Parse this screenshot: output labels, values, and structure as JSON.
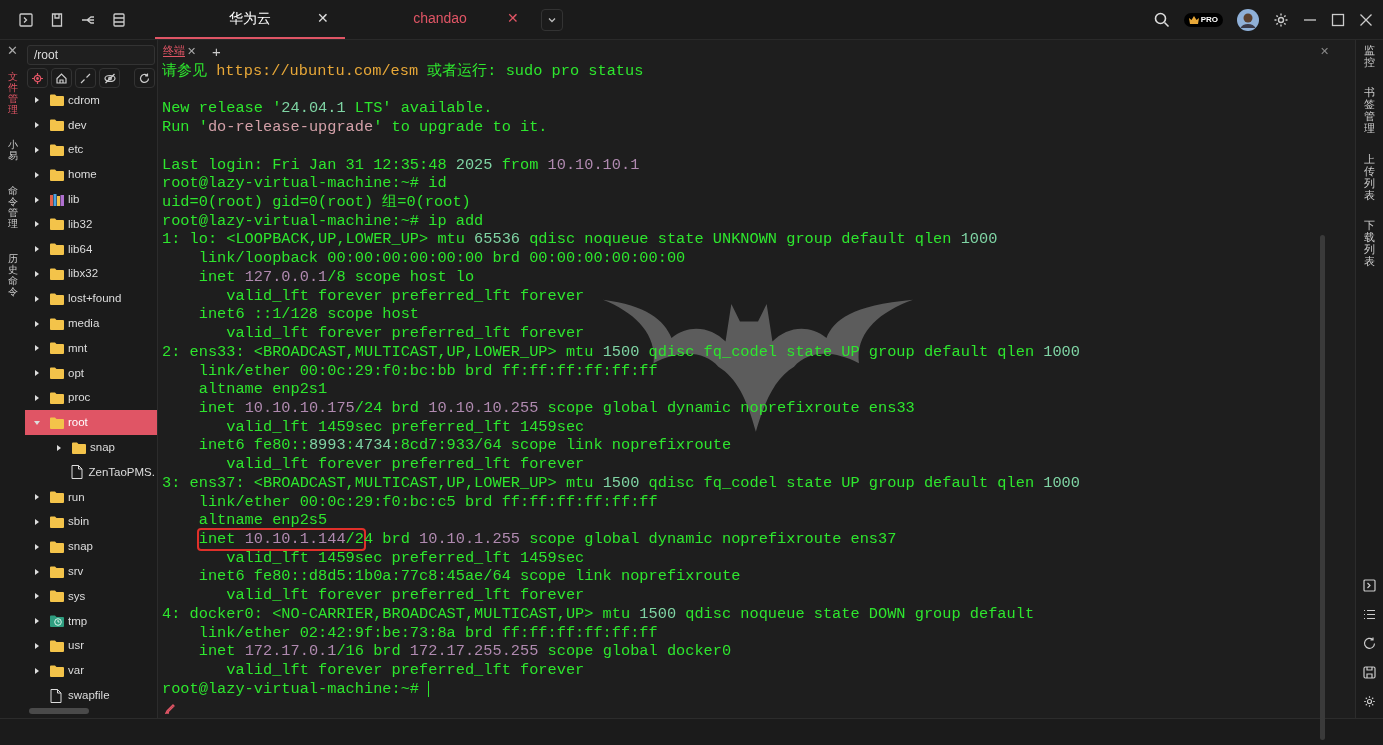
{
  "tabs": [
    {
      "label": "华为云",
      "selected": true,
      "close": "✕"
    },
    {
      "label": "chandao",
      "selected": false,
      "close": "✕"
    }
  ],
  "pro_badge": "PRO",
  "left_rail": {
    "close": "✕",
    "items": [
      {
        "label": "文件管理",
        "selected": true
      },
      {
        "label": "小易",
        "selected": false
      },
      {
        "label": "命令管理",
        "selected": false
      },
      {
        "label": "历史命令",
        "selected": false
      }
    ]
  },
  "file_panel": {
    "path": "/root",
    "tree": [
      {
        "label": "cdrom",
        "kind": "folder",
        "expanded": false,
        "selected": false
      },
      {
        "label": "dev",
        "kind": "folder",
        "expanded": false,
        "selected": false
      },
      {
        "label": "etc",
        "kind": "folder",
        "expanded": false,
        "selected": false
      },
      {
        "label": "home",
        "kind": "folder",
        "expanded": false,
        "selected": false
      },
      {
        "label": "lib",
        "kind": "library",
        "expanded": false,
        "selected": false
      },
      {
        "label": "lib32",
        "kind": "folder",
        "expanded": false,
        "selected": false
      },
      {
        "label": "lib64",
        "kind": "folder",
        "expanded": false,
        "selected": false
      },
      {
        "label": "libx32",
        "kind": "folder",
        "expanded": false,
        "selected": false
      },
      {
        "label": "lost+found",
        "kind": "folder",
        "expanded": false,
        "selected": false
      },
      {
        "label": "media",
        "kind": "folder",
        "expanded": false,
        "selected": false
      },
      {
        "label": "mnt",
        "kind": "folder",
        "expanded": false,
        "selected": false
      },
      {
        "label": "opt",
        "kind": "folder",
        "expanded": false,
        "selected": false
      },
      {
        "label": "proc",
        "kind": "folder",
        "expanded": false,
        "selected": false
      },
      {
        "label": "root",
        "kind": "folder",
        "expanded": true,
        "selected": true,
        "children": [
          {
            "label": "snap",
            "kind": "folder",
            "expanded": false,
            "selected": false
          },
          {
            "label": "ZenTaoPMS.",
            "kind": "file",
            "selected": false
          }
        ]
      },
      {
        "label": "run",
        "kind": "folder",
        "expanded": false,
        "selected": false
      },
      {
        "label": "sbin",
        "kind": "folder",
        "expanded": false,
        "selected": false
      },
      {
        "label": "snap",
        "kind": "folder",
        "expanded": false,
        "selected": false
      },
      {
        "label": "srv",
        "kind": "folder",
        "expanded": false,
        "selected": false
      },
      {
        "label": "sys",
        "kind": "folder",
        "expanded": false,
        "selected": false
      },
      {
        "label": "tmp",
        "kind": "temp",
        "expanded": false,
        "selected": false
      },
      {
        "label": "usr",
        "kind": "folder",
        "expanded": false,
        "selected": false
      },
      {
        "label": "var",
        "kind": "folder",
        "expanded": false,
        "selected": false
      },
      {
        "label": "swapfile",
        "kind": "file",
        "selected": false
      }
    ]
  },
  "terminal": {
    "tab": {
      "label": "终端",
      "close": "✕",
      "add": "+"
    },
    "close": "✕",
    "lines": [
      {
        "kind": "text",
        "segments": [
          {
            "text": "请参见 ",
            "color": "#2ee62e"
          },
          {
            "text": "https://ubuntu.com/esm",
            "color": "#e8a838"
          },
          {
            "text": " 或者运行: sudo pro status",
            "color": "#2ee62e"
          }
        ]
      },
      {
        "kind": "blank"
      },
      {
        "kind": "text",
        "segments": [
          {
            "text": "New release '",
            "color": "#2ee62e"
          },
          {
            "text": "24.04.1",
            "color": "#7fd4a4"
          },
          {
            "text": " LTS' available.",
            "color": "#2ee62e"
          }
        ]
      },
      {
        "kind": "text",
        "segments": [
          {
            "text": "Run '",
            "color": "#2ee62e"
          },
          {
            "text": "do-release-upgrade",
            "color": "#d3a0a8"
          },
          {
            "text": "' to upgrade to it.",
            "color": "#2ee62e"
          }
        ]
      },
      {
        "kind": "blank"
      },
      {
        "kind": "text",
        "segments": [
          {
            "text": "Last login: Fri Jan 31 12:35:48 ",
            "color": "#2ee62e"
          },
          {
            "text": "2025",
            "color": "#7fd4a4"
          },
          {
            "text": " from ",
            "color": "#2ee62e"
          },
          {
            "text": "10.10.10.1",
            "color": "#b08ab0"
          }
        ]
      },
      {
        "kind": "text",
        "segments": [
          {
            "text": "root@lazy-virtual-machine:~# id",
            "color": "#2ee62e"
          }
        ]
      },
      {
        "kind": "text",
        "segments": [
          {
            "text": "uid=0(root) gid=0(root) 组=0(root)",
            "color": "#2ee62e"
          }
        ]
      },
      {
        "kind": "text",
        "segments": [
          {
            "text": "root@lazy-virtual-machine:~# ip add",
            "color": "#2ee62e"
          }
        ]
      },
      {
        "kind": "text",
        "segments": [
          {
            "text": "1: lo: <LOOPBACK,UP,LOWER_UP> mtu ",
            "color": "#2ee62e"
          },
          {
            "text": "65536",
            "color": "#7fd4a4"
          },
          {
            "text": " qdisc noqueue state UNKNOWN group default qlen ",
            "color": "#2ee62e"
          },
          {
            "text": "1000",
            "color": "#7fd4a4"
          }
        ]
      },
      {
        "kind": "text",
        "segments": [
          {
            "text": "    link/loopback 00:00:00:00:00:00 brd 00:00:00:00:00:00",
            "color": "#2ee62e"
          }
        ]
      },
      {
        "kind": "text",
        "segments": [
          {
            "text": "    inet ",
            "color": "#2ee62e"
          },
          {
            "text": "127.0.0.1",
            "color": "#b08ab0"
          },
          {
            "text": "/8 scope host lo",
            "color": "#2ee62e"
          }
        ]
      },
      {
        "kind": "text",
        "segments": [
          {
            "text": "       valid_lft forever preferred_lft forever",
            "color": "#2ee62e"
          }
        ]
      },
      {
        "kind": "text",
        "segments": [
          {
            "text": "    inet6 ::1/128 scope host",
            "color": "#2ee62e"
          }
        ]
      },
      {
        "kind": "text",
        "segments": [
          {
            "text": "       valid_lft forever preferred_lft forever",
            "color": "#2ee62e"
          }
        ]
      },
      {
        "kind": "text",
        "segments": [
          {
            "text": "2: ens33: <BROADCAST,MULTICAST,UP,LOWER_UP> mtu ",
            "color": "#2ee62e"
          },
          {
            "text": "1500",
            "color": "#7fd4a4"
          },
          {
            "text": " qdisc fq_codel state UP group default qlen ",
            "color": "#2ee62e"
          },
          {
            "text": "1000",
            "color": "#7fd4a4"
          }
        ]
      },
      {
        "kind": "text",
        "segments": [
          {
            "text": "    link/ether 00:0c:29:f0:bc:bb brd ff:ff:ff:ff:ff:ff",
            "color": "#2ee62e"
          }
        ]
      },
      {
        "kind": "text",
        "segments": [
          {
            "text": "    altname enp2s1",
            "color": "#2ee62e"
          }
        ]
      },
      {
        "kind": "text",
        "segments": [
          {
            "text": "    inet ",
            "color": "#2ee62e"
          },
          {
            "text": "10.10.10.175",
            "color": "#b08ab0"
          },
          {
            "text": "/24 brd ",
            "color": "#2ee62e"
          },
          {
            "text": "10.10.10.255",
            "color": "#b08ab0"
          },
          {
            "text": " scope global dynamic noprefixroute ens33",
            "color": "#2ee62e"
          }
        ]
      },
      {
        "kind": "text",
        "segments": [
          {
            "text": "       valid_lft 1459sec preferred_lft 1459sec",
            "color": "#2ee62e"
          }
        ]
      },
      {
        "kind": "text",
        "segments": [
          {
            "text": "    inet6 fe80::",
            "color": "#2ee62e"
          },
          {
            "text": "8993",
            "color": "#7fd4a4"
          },
          {
            "text": ":",
            "color": "#2ee62e"
          },
          {
            "text": "4734",
            "color": "#7fd4a4"
          },
          {
            "text": ":8cd7:933/64 scope link noprefixroute",
            "color": "#2ee62e"
          }
        ]
      },
      {
        "kind": "text",
        "segments": [
          {
            "text": "       valid_lft forever preferred_lft forever",
            "color": "#2ee62e"
          }
        ]
      },
      {
        "kind": "text",
        "segments": [
          {
            "text": "3: ens37: <BROADCAST,MULTICAST,UP,LOWER_UP> mtu ",
            "color": "#2ee62e"
          },
          {
            "text": "1500",
            "color": "#7fd4a4"
          },
          {
            "text": " qdisc fq_codel state UP group default qlen ",
            "color": "#2ee62e"
          },
          {
            "text": "1000",
            "color": "#7fd4a4"
          }
        ]
      },
      {
        "kind": "text",
        "segments": [
          {
            "text": "    link/ether 00:0c:29:f0:bc:c5 brd ff:ff:ff:ff:ff:ff",
            "color": "#2ee62e"
          }
        ]
      },
      {
        "kind": "text",
        "segments": [
          {
            "text": "    altname enp2s5",
            "color": "#2ee62e"
          }
        ]
      },
      {
        "kind": "text",
        "segments": [
          {
            "text": "    inet ",
            "color": "#2ee62e",
            "boxed": true
          },
          {
            "text": "10.10.1.144",
            "color": "#b08ab0",
            "boxed": true
          },
          {
            "text": "/2",
            "color": "#2ee62e",
            "boxed": true
          },
          {
            "text": "4 brd ",
            "color": "#2ee62e"
          },
          {
            "text": "10.10.1.255",
            "color": "#b08ab0"
          },
          {
            "text": " scope global dynamic noprefixroute ens37",
            "color": "#2ee62e"
          }
        ]
      },
      {
        "kind": "text",
        "segments": [
          {
            "text": "       valid_lft 1459sec preferred_lft 1459sec",
            "color": "#2ee62e"
          }
        ]
      },
      {
        "kind": "text",
        "segments": [
          {
            "text": "    inet6 fe80::d8d5:1b0a:77c8:45ae/64 scope link noprefixroute",
            "color": "#2ee62e"
          }
        ]
      },
      {
        "kind": "text",
        "segments": [
          {
            "text": "       valid_lft forever preferred_lft forever",
            "color": "#2ee62e"
          }
        ]
      },
      {
        "kind": "text",
        "segments": [
          {
            "text": "4: docker0: <NO-CARRIER,BROADCAST,MULTICAST,UP> mtu ",
            "color": "#2ee62e"
          },
          {
            "text": "1500",
            "color": "#7fd4a4"
          },
          {
            "text": " qdisc noqueue state DOWN group default",
            "color": "#2ee62e"
          }
        ]
      },
      {
        "kind": "text",
        "segments": [
          {
            "text": "    link/ether 02:42:9f:be:73:8a brd ff:ff:ff:ff:ff:ff",
            "color": "#2ee62e"
          }
        ]
      },
      {
        "kind": "text",
        "segments": [
          {
            "text": "    inet ",
            "color": "#2ee62e"
          },
          {
            "text": "172.17.0.1",
            "color": "#b08ab0"
          },
          {
            "text": "/16 brd ",
            "color": "#2ee62e"
          },
          {
            "text": "172.17.255.255",
            "color": "#b08ab0"
          },
          {
            "text": " scope global docker0",
            "color": "#2ee62e"
          }
        ]
      },
      {
        "kind": "text",
        "segments": [
          {
            "text": "       valid_lft forever preferred_lft forever",
            "color": "#2ee62e"
          }
        ]
      },
      {
        "kind": "prompt",
        "segments": [
          {
            "text": "root@lazy-virtual-machine:~# ",
            "color": "#2ee62e"
          }
        ]
      }
    ]
  },
  "right_rail": [
    {
      "label": "监控"
    },
    {
      "label": "书签管理"
    },
    {
      "label": "上传列表"
    },
    {
      "label": "下载列表"
    }
  ]
}
